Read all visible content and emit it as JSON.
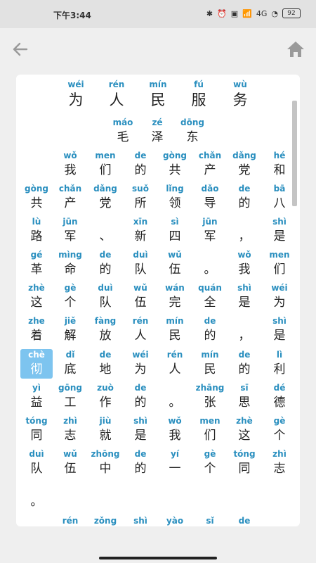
{
  "status": {
    "time": "下午3:44",
    "battery": "92",
    "net": "4G"
  },
  "title": [
    {
      "py": "wéi",
      "hz": "为"
    },
    {
      "py": "rén",
      "hz": "人"
    },
    {
      "py": "mín",
      "hz": "民"
    },
    {
      "py": "fú",
      "hz": "服"
    },
    {
      "py": "wù",
      "hz": "务"
    }
  ],
  "author": [
    {
      "py": "máo",
      "hz": "毛"
    },
    {
      "py": "zé",
      "hz": "泽"
    },
    {
      "py": "dōng",
      "hz": "东"
    }
  ],
  "rows": [
    [
      {
        "py": "",
        "hz": ""
      },
      {
        "py": "wǒ",
        "hz": "我"
      },
      {
        "py": "men",
        "hz": "们"
      },
      {
        "py": "de",
        "hz": "的"
      },
      {
        "py": "gòng",
        "hz": "共"
      },
      {
        "py": "chǎn",
        "hz": "产"
      },
      {
        "py": "dǎng",
        "hz": "党"
      },
      {
        "py": "hé",
        "hz": "和"
      }
    ],
    [
      {
        "py": "gòng",
        "hz": "共"
      },
      {
        "py": "chǎn",
        "hz": "产"
      },
      {
        "py": "dǎng",
        "hz": "党"
      },
      {
        "py": "suǒ",
        "hz": "所"
      },
      {
        "py": "lǐng",
        "hz": "领"
      },
      {
        "py": "dǎo",
        "hz": "导"
      },
      {
        "py": "de",
        "hz": "的"
      },
      {
        "py": "bā",
        "hz": "八"
      }
    ],
    [
      {
        "py": "lù",
        "hz": "路"
      },
      {
        "py": "jūn",
        "hz": "军"
      },
      {
        "py": "",
        "hz": "、"
      },
      {
        "py": "xīn",
        "hz": "新"
      },
      {
        "py": "sì",
        "hz": "四"
      },
      {
        "py": "jūn",
        "hz": "军"
      },
      {
        "py": "",
        "hz": "，"
      },
      {
        "py": "shì",
        "hz": "是"
      }
    ],
    [
      {
        "py": "gé",
        "hz": "革"
      },
      {
        "py": "mìng",
        "hz": "命"
      },
      {
        "py": "de",
        "hz": "的"
      },
      {
        "py": "duì",
        "hz": "队"
      },
      {
        "py": "wǔ",
        "hz": "伍"
      },
      {
        "py": "",
        "hz": "。"
      },
      {
        "py": "wǒ",
        "hz": "我"
      },
      {
        "py": "men",
        "hz": "们"
      }
    ],
    [
      {
        "py": "zhè",
        "hz": "这"
      },
      {
        "py": "gè",
        "hz": "个"
      },
      {
        "py": "duì",
        "hz": "队"
      },
      {
        "py": "wǔ",
        "hz": "伍"
      },
      {
        "py": "wán",
        "hz": "完"
      },
      {
        "py": "quán",
        "hz": "全"
      },
      {
        "py": "shì",
        "hz": "是"
      },
      {
        "py": "wéi",
        "hz": "为"
      }
    ],
    [
      {
        "py": "zhe",
        "hz": "着"
      },
      {
        "py": "jiě",
        "hz": "解"
      },
      {
        "py": "fàng",
        "hz": "放"
      },
      {
        "py": "rén",
        "hz": "人"
      },
      {
        "py": "mín",
        "hz": "民"
      },
      {
        "py": "de",
        "hz": "的"
      },
      {
        "py": "",
        "hz": "，"
      },
      {
        "py": "shì",
        "hz": "是"
      }
    ],
    [
      {
        "py": "chè",
        "hz": "彻",
        "hl": true
      },
      {
        "py": "dǐ",
        "hz": "底"
      },
      {
        "py": "de",
        "hz": "地"
      },
      {
        "py": "wéi",
        "hz": "为"
      },
      {
        "py": "rén",
        "hz": "人"
      },
      {
        "py": "mín",
        "hz": "民"
      },
      {
        "py": "de",
        "hz": "的"
      },
      {
        "py": "lì",
        "hz": "利"
      }
    ],
    [
      {
        "py": "yì",
        "hz": "益"
      },
      {
        "py": "gōng",
        "hz": "工"
      },
      {
        "py": "zuò",
        "hz": "作"
      },
      {
        "py": "de",
        "hz": "的"
      },
      {
        "py": "",
        "hz": "。"
      },
      {
        "py": "zhāng",
        "hz": "张"
      },
      {
        "py": "sī",
        "hz": "思"
      },
      {
        "py": "dé",
        "hz": "德"
      }
    ],
    [
      {
        "py": "tóng",
        "hz": "同"
      },
      {
        "py": "zhì",
        "hz": "志"
      },
      {
        "py": "jiù",
        "hz": "就"
      },
      {
        "py": "shì",
        "hz": "是"
      },
      {
        "py": "wǒ",
        "hz": "我"
      },
      {
        "py": "men",
        "hz": "们"
      },
      {
        "py": "zhè",
        "hz": "这"
      },
      {
        "py": "gè",
        "hz": "个"
      }
    ],
    [
      {
        "py": "duì",
        "hz": "队"
      },
      {
        "py": "wǔ",
        "hz": "伍"
      },
      {
        "py": "zhōng",
        "hz": "中"
      },
      {
        "py": "de",
        "hz": "的"
      },
      {
        "py": "yí",
        "hz": "一"
      },
      {
        "py": "gè",
        "hz": "个"
      },
      {
        "py": "tóng",
        "hz": "同"
      },
      {
        "py": "zhì",
        "hz": "志"
      }
    ],
    [
      {
        "py": "",
        "hz": "。"
      }
    ],
    [
      {
        "py": "",
        "hz": ""
      },
      {
        "py": "rén",
        "hz": ""
      },
      {
        "py": "zǒng",
        "hz": ""
      },
      {
        "py": "shì",
        "hz": ""
      },
      {
        "py": "yào",
        "hz": ""
      },
      {
        "py": "sǐ",
        "hz": ""
      },
      {
        "py": "de",
        "hz": ""
      }
    ]
  ]
}
